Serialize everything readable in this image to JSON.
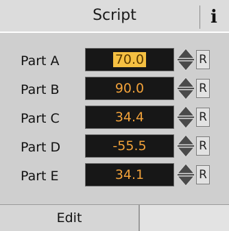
{
  "header": {
    "title": "Script",
    "info_label": "i"
  },
  "parts": [
    {
      "label": "Part A",
      "value": "70.0",
      "selected": true,
      "reset_label": "R"
    },
    {
      "label": "Part B",
      "value": "90.0",
      "selected": false,
      "reset_label": "R"
    },
    {
      "label": "Part C",
      "value": "34.4",
      "selected": false,
      "reset_label": "R"
    },
    {
      "label": "Part D",
      "value": "-55.5",
      "selected": false,
      "reset_label": "R"
    },
    {
      "label": "Part E",
      "value": "34.1",
      "selected": false,
      "reset_label": "R"
    }
  ],
  "footer": {
    "edit_tab_label": "Edit"
  },
  "colors": {
    "value_text": "#f2a23a",
    "value_bg": "#171717",
    "selection_bg": "#f5c042"
  }
}
